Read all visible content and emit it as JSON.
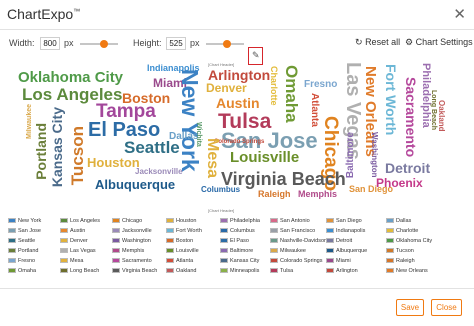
{
  "dialog": {
    "title": "ChartExpo",
    "title_mark": "™",
    "close_glyph": "✕"
  },
  "controls": {
    "width_label": "Width:",
    "width_value": "800",
    "width_unit": "px",
    "width_slider_level": 0.62,
    "height_label": "Height:",
    "height_value": "525",
    "height_unit": "px",
    "height_slider_level": 0.55,
    "reset_label": "Reset all",
    "reset_icon": "refresh-icon",
    "settings_label": "Chart Settings",
    "settings_icon": "sliders-icon",
    "edit_icon": "pencil-icon",
    "chart_header_label": "[Chart Header]"
  },
  "cloud_words": [
    {
      "text": "Indianapolis",
      "color": "#3d8fd1"
    },
    {
      "text": "Oklahoma City",
      "color": "#4f9a48"
    },
    {
      "text": "Miami",
      "color": "#9a4a8c"
    },
    {
      "text": "Arlington",
      "color": "#c24a3c"
    },
    {
      "text": "Los Angeles",
      "color": "#5c8a3c"
    },
    {
      "text": "Boston",
      "color": "#d66b2a"
    },
    {
      "text": "Tampa",
      "color": "#a3479b"
    },
    {
      "text": "Denver",
      "color": "#e0b13d"
    },
    {
      "text": "Austin",
      "color": "#e5872d"
    },
    {
      "text": "New York",
      "color": "#3c82c4"
    },
    {
      "text": "Tulsa",
      "color": "#b33b5a"
    },
    {
      "text": "Charlotte",
      "color": "#e3bc3a"
    },
    {
      "text": "Omaha",
      "color": "#6f9a34"
    },
    {
      "text": "Fresno",
      "color": "#7aa6cf"
    },
    {
      "text": "Atlanta",
      "color": "#d24f3a"
    },
    {
      "text": "Las Vegas",
      "color": "#b0b0b0"
    },
    {
      "text": "New Orleans",
      "color": "#e07b2a"
    },
    {
      "text": "Fort Worth",
      "color": "#6cb7d6"
    },
    {
      "text": "Philadelphia",
      "color": "#9c6fb0"
    },
    {
      "text": "Sacramento",
      "color": "#b5489c"
    },
    {
      "text": "Long Beach",
      "color": "#6e6e2d"
    },
    {
      "text": "Oakland",
      "color": "#c25a5a"
    },
    {
      "text": "El Paso",
      "color": "#2c6ca6"
    },
    {
      "text": "Seattle",
      "color": "#2f6f86"
    },
    {
      "text": "San Jose",
      "color": "#7b9fb2"
    },
    {
      "text": "Kansas City",
      "color": "#4a6a8a"
    },
    {
      "text": "Portland",
      "color": "#6b7f3a"
    },
    {
      "text": "Milwaukee",
      "color": "#d9a84a"
    },
    {
      "text": "Tucson",
      "color": "#d07a2a"
    },
    {
      "text": "Dallas",
      "color": "#6aa0c8"
    },
    {
      "text": "Wichita",
      "color": "#5a9a6a"
    },
    {
      "text": "Colorado Springs",
      "color": "#c24a3c"
    },
    {
      "text": "Mesa",
      "color": "#e0b13d"
    },
    {
      "text": "Chicago",
      "color": "#e0831f"
    },
    {
      "text": "Louisville",
      "color": "#6a8f2a"
    },
    {
      "text": "Houston",
      "color": "#e0b13d"
    },
    {
      "text": "Jacksonville",
      "color": "#9a8ab8"
    },
    {
      "text": "Baltimore",
      "color": "#8a6ab0"
    },
    {
      "text": "Detroit",
      "color": "#7a7aa0"
    },
    {
      "text": "Albuquerque",
      "color": "#1e5a8a"
    },
    {
      "text": "Virginia Beach",
      "color": "#5a5a5a"
    },
    {
      "text": "Phoenix",
      "color": "#c43a8a"
    },
    {
      "text": "Columbus",
      "color": "#2a6aa8"
    },
    {
      "text": "Raleigh",
      "color": "#d6762a"
    },
    {
      "text": "Memphis",
      "color": "#b04a8a"
    },
    {
      "text": "San Diego",
      "color": "#e0933a"
    },
    {
      "text": "Washington",
      "color": "#7a5aa0"
    }
  ],
  "legend": [
    {
      "label": "New York",
      "color": "#3c82c4"
    },
    {
      "label": "Los Angeles",
      "color": "#5c8a3c"
    },
    {
      "label": "Chicago",
      "color": "#e0831f"
    },
    {
      "label": "Houston",
      "color": "#e0b13d"
    },
    {
      "label": "Philadelphia",
      "color": "#9c6fb0"
    },
    {
      "label": "San Antonio",
      "color": "#d86a8a"
    },
    {
      "label": "San Diego",
      "color": "#e0933a"
    },
    {
      "label": "Dallas",
      "color": "#6aa0c8"
    },
    {
      "label": "San Jose",
      "color": "#7b9fb2"
    },
    {
      "label": "Austin",
      "color": "#e5872d"
    },
    {
      "label": "Jacksonville",
      "color": "#9a8ab8"
    },
    {
      "label": "Fort Worth",
      "color": "#6cb7d6"
    },
    {
      "label": "Columbus",
      "color": "#2a6aa8"
    },
    {
      "label": "San Francisco",
      "color": "#9aa0a8"
    },
    {
      "label": "Indianapolis",
      "color": "#3d8fd1"
    },
    {
      "label": "Charlotte",
      "color": "#e3bc3a"
    },
    {
      "label": "Seattle",
      "color": "#2f6f86"
    },
    {
      "label": "Denver",
      "color": "#e0b13d"
    },
    {
      "label": "Washington",
      "color": "#7a5aa0"
    },
    {
      "label": "Boston",
      "color": "#d66b2a"
    },
    {
      "label": "El Paso",
      "color": "#2c6ca6"
    },
    {
      "label": "Nashville-Davidson",
      "color": "#6a9a8a"
    },
    {
      "label": "Detroit",
      "color": "#7a7aa0"
    },
    {
      "label": "Oklahoma City",
      "color": "#4f9a48"
    },
    {
      "label": "Portland",
      "color": "#6b7f3a"
    },
    {
      "label": "Las Vegas",
      "color": "#b0b0b0"
    },
    {
      "label": "Memphis",
      "color": "#b04a8a"
    },
    {
      "label": "Louisville",
      "color": "#6a8f2a"
    },
    {
      "label": "Baltimore",
      "color": "#8a6ab0"
    },
    {
      "label": "Milwaukee",
      "color": "#d9a84a"
    },
    {
      "label": "Albuquerque",
      "color": "#1e5a8a"
    },
    {
      "label": "Tucson",
      "color": "#d07a2a"
    },
    {
      "label": "Fresno",
      "color": "#7aa6cf"
    },
    {
      "label": "Mesa",
      "color": "#e0b13d"
    },
    {
      "label": "Sacramento",
      "color": "#b5489c"
    },
    {
      "label": "Atlanta",
      "color": "#d24f3a"
    },
    {
      "label": "Kansas City",
      "color": "#4a6a8a"
    },
    {
      "label": "Colorado Springs",
      "color": "#c24a3c"
    },
    {
      "label": "Miami",
      "color": "#9a4a8c"
    },
    {
      "label": "Raleigh",
      "color": "#d6762a"
    },
    {
      "label": "Omaha",
      "color": "#6f9a34"
    },
    {
      "label": "Long Beach",
      "color": "#6e6e2d"
    },
    {
      "label": "Virginia Beach",
      "color": "#5a5a5a"
    },
    {
      "label": "Oakland",
      "color": "#c25a5a"
    },
    {
      "label": "Minneapolis",
      "color": "#8ab04a"
    },
    {
      "label": "Tulsa",
      "color": "#b33b5a"
    },
    {
      "label": "Arlington",
      "color": "#c24a3c"
    },
    {
      "label": "New Orleans",
      "color": "#e07b2a"
    }
  ],
  "footer": {
    "save_label": "Save",
    "close_label": "Close",
    "accent": "#f07a12"
  }
}
